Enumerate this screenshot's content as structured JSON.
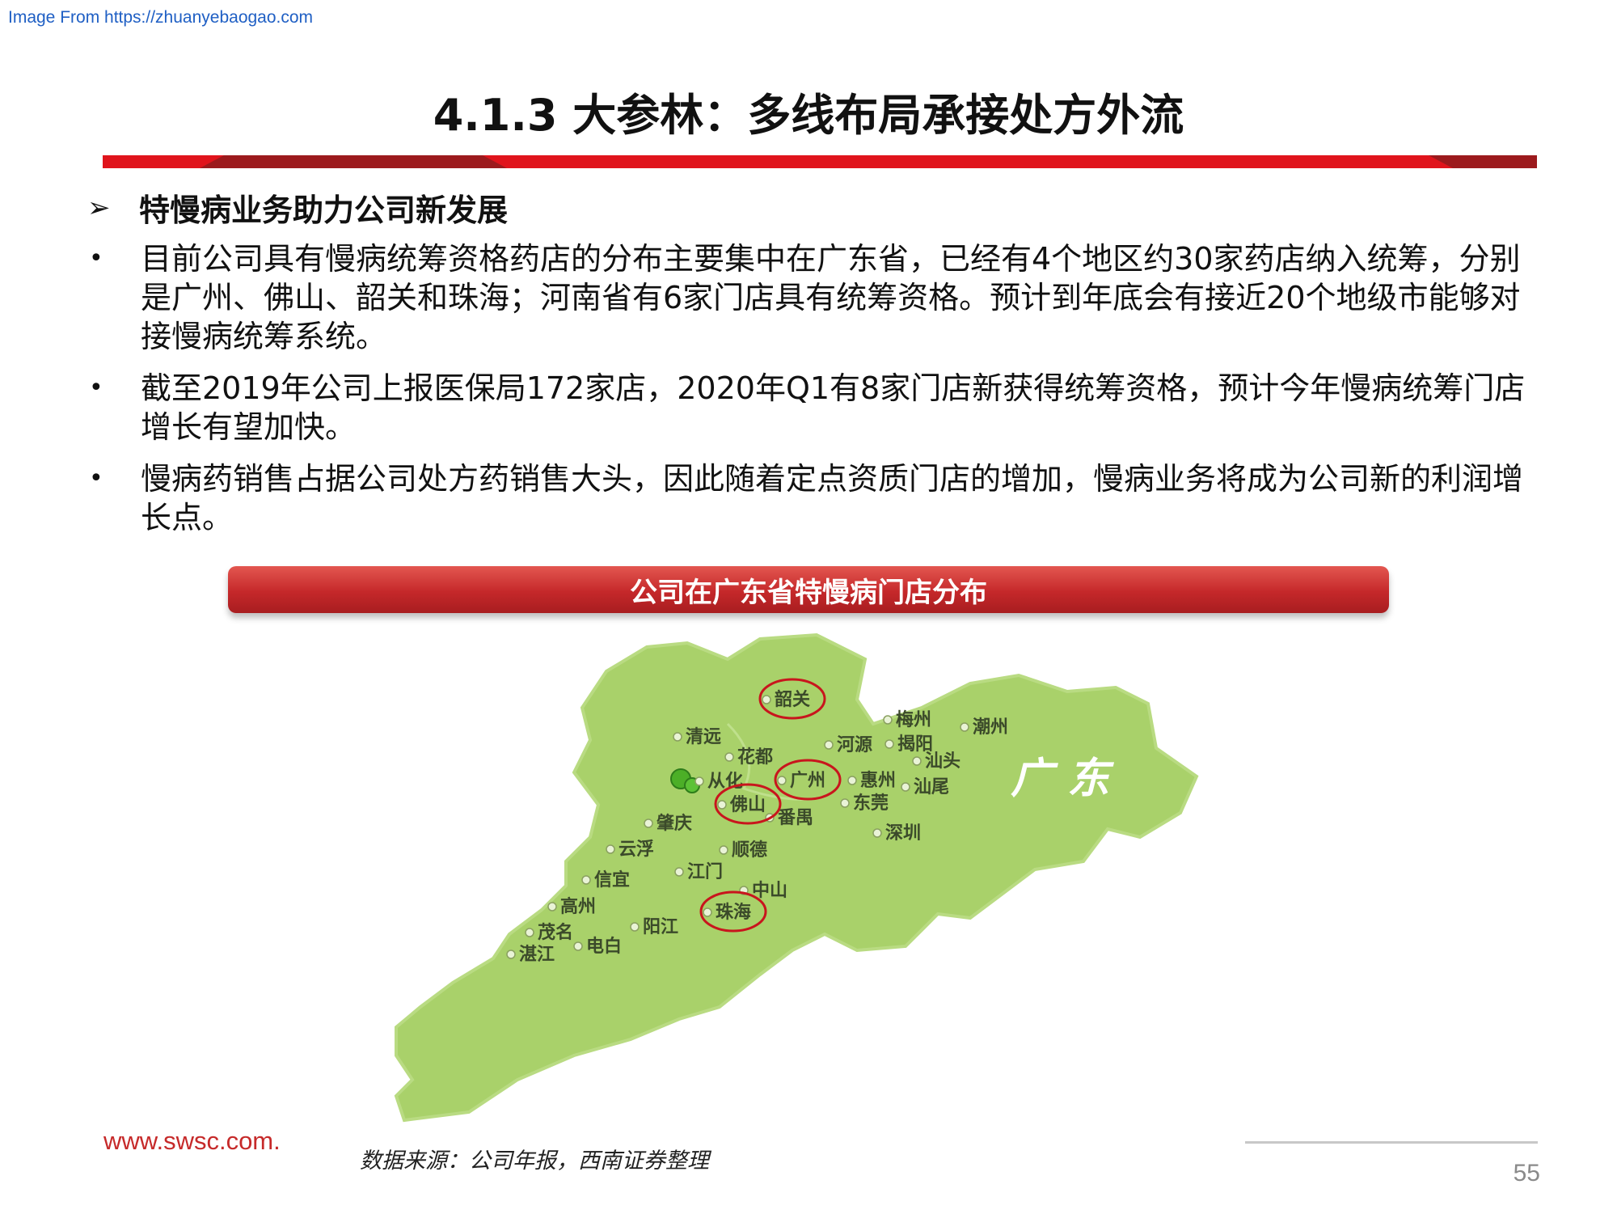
{
  "source_link": "Image From https://zhuanyebaogao.com",
  "title": "4.1.3 大参林：多线布局承接处方外流",
  "section": {
    "arrow_glyph": "➢",
    "heading": "特慢病业务助力公司新发展"
  },
  "bullets": [
    {
      "glyph": "•",
      "text": "目前公司具有慢病统筹资格药店的分布主要集中在广东省，已经有4个地区约30家药店纳入统筹，分别是广州、佛山、韶关和珠海；河南省有6家门店具有统筹资格。预计到年底会有接近20个地级市能够对接慢病统筹系统。"
    },
    {
      "glyph": "•",
      "text": "截至2019年公司上报医保局172家店，2020年Q1有8家门店新获得统筹资格，预计今年慢病统筹门店增长有望加快。"
    },
    {
      "glyph": "•",
      "text": "慢病药销售占据公司处方药销售大头，因此随着定点资质门店的增加，慢病业务将成为公司新的利润增长点。"
    }
  ],
  "map": {
    "header": "公司在广东省特慢病门店分布",
    "province_label": "广 东",
    "cities": [
      {
        "name": "韶关"
      },
      {
        "name": "清远"
      },
      {
        "name": "花都"
      },
      {
        "name": "河源"
      },
      {
        "name": "梅州"
      },
      {
        "name": "潮州"
      },
      {
        "name": "揭阳"
      },
      {
        "name": "汕头"
      },
      {
        "name": "惠州"
      },
      {
        "name": "汕尾"
      },
      {
        "name": "东莞"
      },
      {
        "name": "深圳"
      },
      {
        "name": "从化"
      },
      {
        "name": "广州"
      },
      {
        "name": "佛山"
      },
      {
        "name": "番禺"
      },
      {
        "name": "肇庆"
      },
      {
        "name": "云浮"
      },
      {
        "name": "顺德"
      },
      {
        "name": "江门"
      },
      {
        "name": "中山"
      },
      {
        "name": "信宜"
      },
      {
        "name": "高州"
      },
      {
        "name": "珠海"
      },
      {
        "name": "茂名"
      },
      {
        "name": "阳江"
      },
      {
        "name": "湛江"
      },
      {
        "name": "电白"
      }
    ],
    "circled_cities": [
      "韶关",
      "广州",
      "佛山",
      "珠海"
    ],
    "colors": {
      "land": "#a9d16a",
      "circle": "#c8161d"
    }
  },
  "footer": {
    "website": "www.swsc.com.",
    "source_note": "数据来源：公司年报，西南证券整理",
    "page_number": "55"
  }
}
